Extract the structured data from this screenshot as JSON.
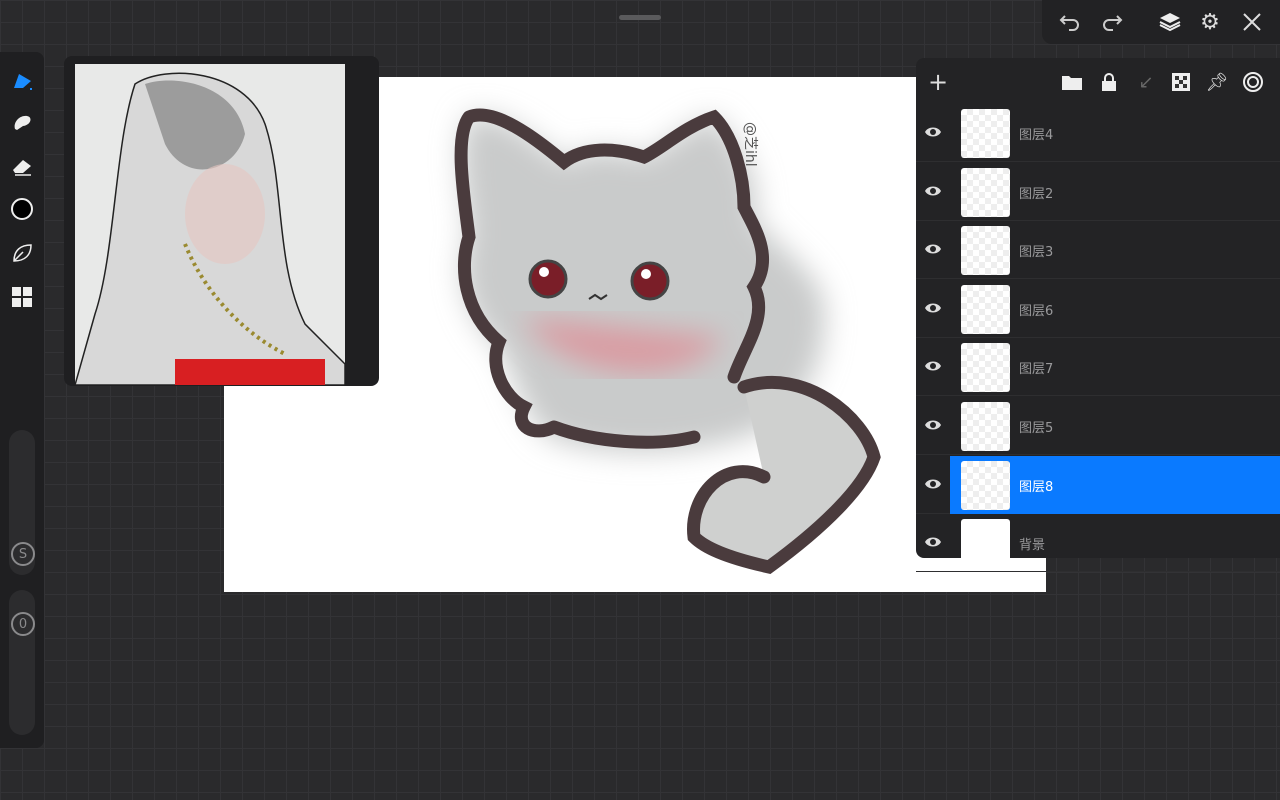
{
  "topbar": {
    "undo": "undo",
    "redo": "redo",
    "layers": "layers",
    "settings": "settings",
    "close": "close"
  },
  "layers_panel": {
    "add_label": "+",
    "layers": [
      {
        "name": "图层4",
        "visible": true,
        "selected": false
      },
      {
        "name": "图层2",
        "visible": true,
        "selected": false
      },
      {
        "name": "图层3",
        "visible": true,
        "selected": false
      },
      {
        "name": "图层6",
        "visible": true,
        "selected": false
      },
      {
        "name": "图层7",
        "visible": true,
        "selected": false
      },
      {
        "name": "图层5",
        "visible": true,
        "selected": false
      },
      {
        "name": "图层8",
        "visible": true,
        "selected": true
      },
      {
        "name": "背景",
        "visible": true,
        "selected": false
      }
    ]
  },
  "sidebar": {
    "size_label": "S",
    "opacity_label": "0"
  },
  "canvas": {
    "signature": "@芝ihl"
  },
  "colors": {
    "accent": "#0a7aff",
    "current_color": "#000000"
  }
}
